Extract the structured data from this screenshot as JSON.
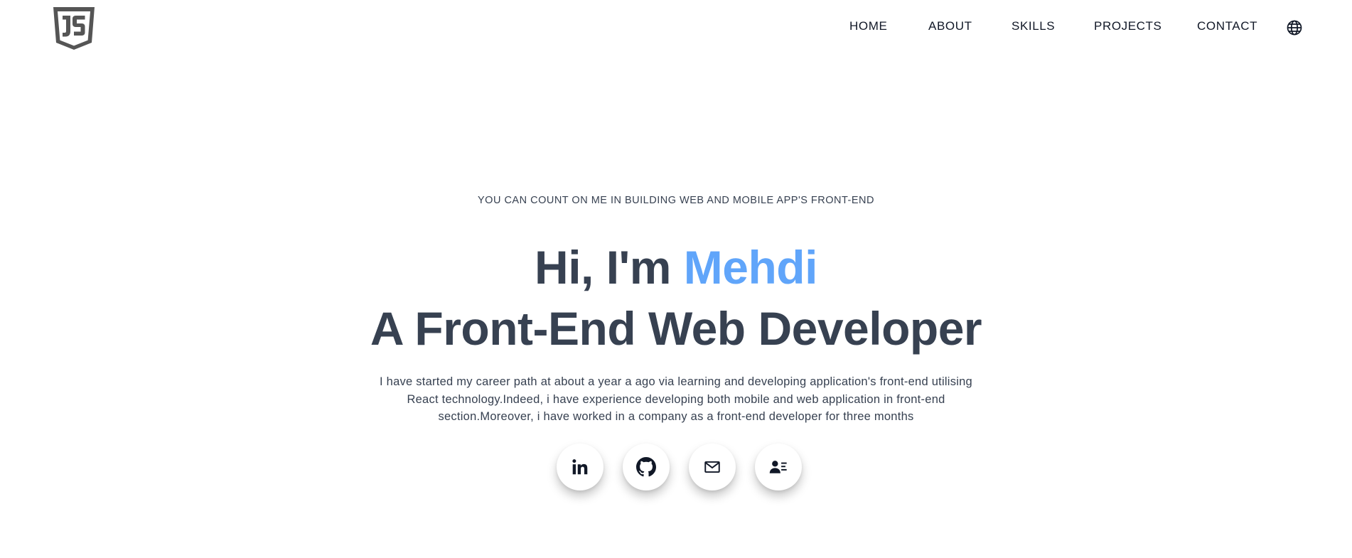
{
  "header": {
    "logo_icon": "js-shield-logo-icon",
    "nav": [
      {
        "label": "HOME"
      },
      {
        "label": "ABOUT"
      },
      {
        "label": "SKILLS"
      },
      {
        "label": "PROJECTS"
      },
      {
        "label": "CONTACT"
      }
    ],
    "language_icon": "globe-icon"
  },
  "hero": {
    "eyebrow": "YOU CAN COUNT ON ME IN BUILDING WEB AND MOBILE APP'S FRONT-END",
    "greeting_prefix": "Hi, I'm ",
    "name": "Mehdi",
    "role": "A Front-End Web Developer",
    "description": "I have started my career path at about a year a ago via learning and developing application's front-end utilising React technology.Indeed, i have experience developing both mobile and web application in front-end section.Moreover, i have worked in a company as a front-end developer for three months",
    "accent_color": "#60a5fa",
    "text_color": "#374151"
  },
  "socials": [
    {
      "icon": "linkedin-icon"
    },
    {
      "icon": "github-icon"
    },
    {
      "icon": "mail-icon"
    },
    {
      "icon": "resume-icon"
    }
  ]
}
